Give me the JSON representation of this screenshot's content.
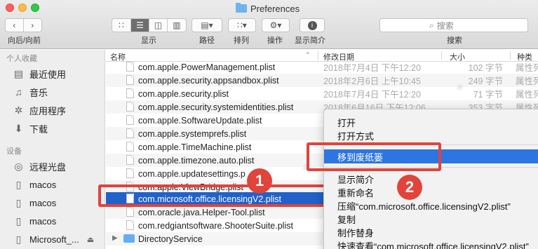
{
  "window": {
    "title": "Preferences"
  },
  "toolbar": {
    "back_forward_label": "向后/向前",
    "view_label": "显示",
    "path_label": "路径",
    "arrange_label": "排列",
    "action_label": "操作",
    "info_label": "显示简介",
    "search_label": "搜索",
    "search_placeholder": "搜索"
  },
  "sidebar": {
    "favorites_header": "个人收藏",
    "favorites": [
      {
        "label": "最近使用",
        "icon": "recents-icon"
      },
      {
        "label": "音乐",
        "icon": "music-icon"
      },
      {
        "label": "应用程序",
        "icon": "applications-icon"
      },
      {
        "label": "下载",
        "icon": "downloads-icon"
      }
    ],
    "devices_header": "设备",
    "devices": [
      {
        "label": "远程光盘",
        "icon": "remote-disc-icon"
      },
      {
        "label": "macos",
        "icon": "disk-icon"
      },
      {
        "label": "macos",
        "icon": "disk-icon"
      },
      {
        "label": "macos",
        "icon": "disk-icon"
      },
      {
        "label": "Microsoft_...",
        "icon": "disk-icon"
      }
    ]
  },
  "columns": {
    "name": "名称",
    "date": "修改日期",
    "size": "大小",
    "kind": "种类"
  },
  "files": [
    {
      "name": "com.apple.PowerManagement.plist",
      "date": "2018年7月4日 下午12:20",
      "size": "102 字节",
      "kind": "属性列"
    },
    {
      "name": "com.apple.security.appsandbox.plist",
      "date": "2018年2月6日 上午10:45",
      "size": "249 字节",
      "kind": "属性列"
    },
    {
      "name": "com.apple.security.plist",
      "date": "2018年7月4日 下午12:20",
      "size": "71 字节",
      "kind": "属性列"
    },
    {
      "name": "com.apple.security.systemidentities.plist",
      "date": "2018年6月16日 下午12:06",
      "size": "353 字节",
      "kind": "属性列"
    },
    {
      "name": "com.apple.SoftwareUpdate.plist",
      "date": "",
      "size": "",
      "kind": ""
    },
    {
      "name": "com.apple.systemprefs.plist",
      "date": "",
      "size": "",
      "kind": ""
    },
    {
      "name": "com.apple.TimeMachine.plist",
      "date": "",
      "size": "",
      "kind": ""
    },
    {
      "name": "com.apple.timezone.auto.plist",
      "date": "",
      "size": "",
      "kind": ""
    },
    {
      "name": "com.apple.updatesettings.p",
      "date": "",
      "size": "",
      "kind": ""
    },
    {
      "name": "com.apple.ViewBridge.plist",
      "date": "",
      "size": "",
      "kind": ""
    },
    {
      "name": "com.microsoft.office.licensingV2.plist",
      "date": "",
      "size": "",
      "kind": ""
    },
    {
      "name": "com.oracle.java.Helper-Tool.plist",
      "date": "",
      "size": "",
      "kind": ""
    },
    {
      "name": "com.redgiantsoftware.ShooterSuite.plist",
      "date": "",
      "size": "",
      "kind": ""
    }
  ],
  "folder_row": {
    "name": "DirectoryService"
  },
  "context_menu": {
    "items": [
      {
        "label": "打开"
      },
      {
        "label": "打开方式"
      },
      {
        "label": "移到废纸篓"
      },
      {
        "label": "显示简介"
      },
      {
        "label": "重新命名"
      },
      {
        "label": "压缩“com.microsoft.office.licensingV2.plist”"
      },
      {
        "label": "复制"
      },
      {
        "label": "制作替身"
      },
      {
        "label": "快速查看“com.microsoft.office.licensingV2.plist”"
      }
    ]
  },
  "annotations": {
    "step1": "1",
    "step2": "2"
  },
  "colors": {
    "selection": "#2161ca",
    "highlight": "#e0443b",
    "menu_selection": "#2c75e3"
  }
}
